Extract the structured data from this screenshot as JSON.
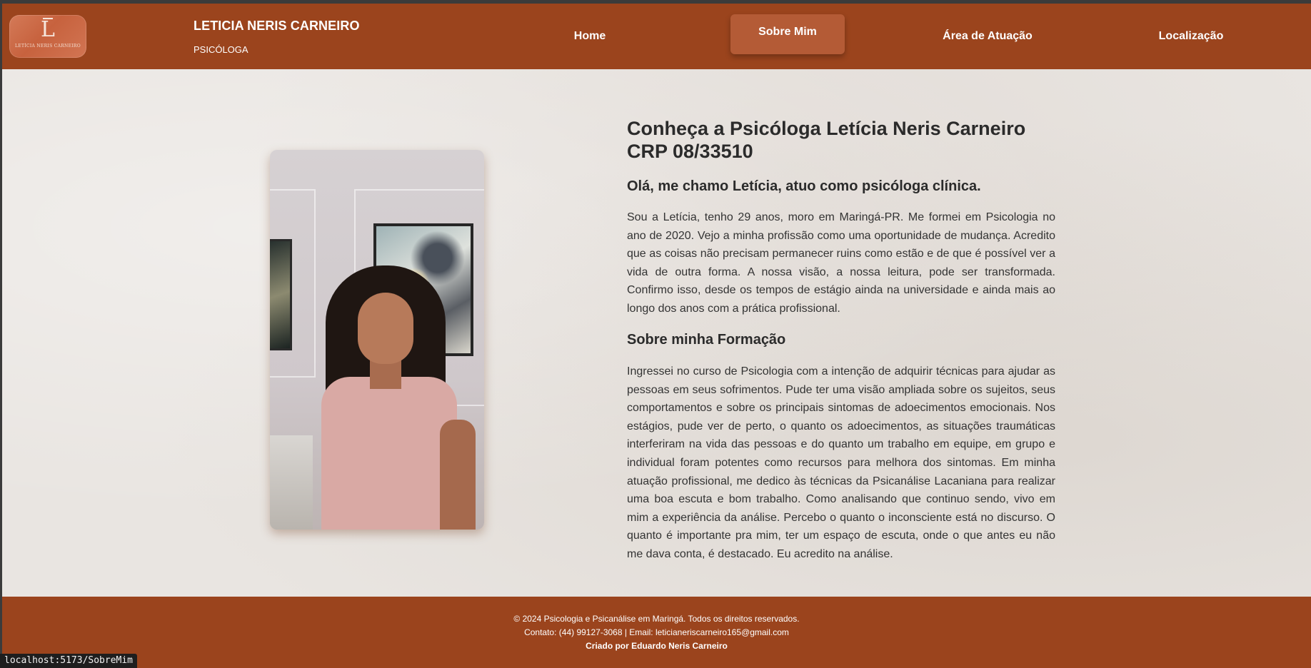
{
  "header": {
    "logo": {
      "mark": "L",
      "text": "LETÍCIA NERIS CARNEIRO"
    },
    "brand_name": "LETICIA NERIS CARNEIRO",
    "brand_subtitle": "PSICÓLOGA",
    "nav": [
      {
        "label": "Home",
        "active": false
      },
      {
        "label": "Sobre Mim",
        "active": true
      },
      {
        "label": "Área de Atuação",
        "active": false
      },
      {
        "label": "Localização",
        "active": false
      }
    ]
  },
  "main": {
    "title": "Conheça a Psicóloga Letícia Neris Carneiro CRP 08/33510",
    "greeting": "Olá, me chamo Letícia, atuo como psicóloga clínica.",
    "intro": "Sou a Letícia, tenho 29 anos, moro em Maringá-PR. Me formei em Psicologia no ano de 2020. Vejo a minha profissão como uma oportunidade de mudança. Acredito que as coisas não precisam permanecer ruins como estão e de que é possível ver a vida de outra forma. A nossa visão, a nossa leitura, pode ser transformada. Confirmo isso, desde os tempos de estágio ainda na universidade e ainda mais ao longo dos anos com a prática profissional.",
    "formation_title": "Sobre minha Formação",
    "formation": "Ingressei no curso de Psicologia com a intenção de adquirir técnicas para ajudar as pessoas em seus sofrimentos. Pude ter uma visão ampliada sobre os sujeitos, seus comportamentos e sobre os principais sintomas de adoecimentos emocionais. Nos estágios, pude ver de perto, o quanto os adoecimentos, as situações traumáticas interferiram na vida das pessoas e do quanto um trabalho em equipe, em grupo e individual foram potentes como recursos para melhora dos sintomas. Em minha atuação profissional, me dedico às técnicas da Psicanálise Lacaniana para realizar uma boa escuta e bom trabalho. Como analisando que continuo sendo, vivo em mim a experiência da análise. Percebo o quanto o inconsciente está no discurso. O quanto é importante pra mim, ter um espaço de escuta, onde o que antes eu não me dava conta, é destacado. Eu acredito na análise."
  },
  "footer": {
    "copyright": "© 2024 Psicologia e Psicanálise em Maringá. Todos os direitos reservados.",
    "contact": "Contato: (44) 99127-3068 | Email: leticianeriscarneiro165@gmail.com",
    "credit": "Criado por Eduardo Neris Carneiro"
  },
  "status_bar": {
    "url": "localhost:5173/SobreMim"
  },
  "colors": {
    "brand": "#9b441d",
    "nav_active": "#b45b36",
    "background": "#e9e5e1",
    "text": "#333333"
  }
}
